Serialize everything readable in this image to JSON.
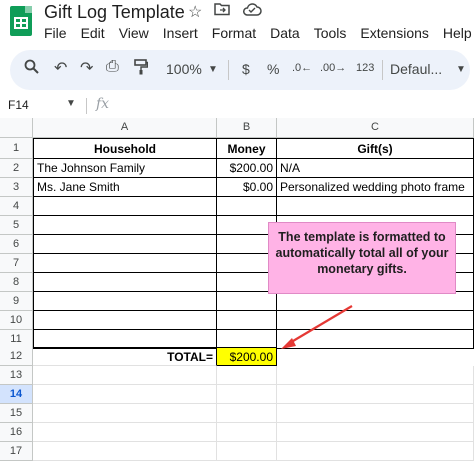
{
  "title_bar": {
    "doc_title": "Gift Log Template",
    "icons": [
      "star-icon",
      "move-to-folder-icon",
      "cloud-status-icon"
    ]
  },
  "menu": {
    "items": [
      "File",
      "Edit",
      "View",
      "Insert",
      "Format",
      "Data",
      "Tools",
      "Extensions",
      "Help"
    ]
  },
  "toolbar": {
    "search_icon": "⌕",
    "undo_icon": "↶",
    "redo_icon": "↷",
    "print_icon": "⎙",
    "paint_format_icon": "⛏",
    "zoom": "100%",
    "currency": "$",
    "percent": "%",
    "decrease_decimal": ".0←",
    "increase_decimal": ".00→",
    "more_formats": "123",
    "font": "Defaul..."
  },
  "formula_bar": {
    "name_box": "F14",
    "fx_label": "fx",
    "value": ""
  },
  "columns": [
    "A",
    "B",
    "C"
  ],
  "rows": [
    "1",
    "2",
    "3",
    "4",
    "5",
    "6",
    "7",
    "8",
    "9",
    "10",
    "11",
    "12",
    "13",
    "14",
    "15",
    "16",
    "17"
  ],
  "selected_row": "14",
  "sheet": {
    "header": {
      "household": "Household",
      "money": "Money",
      "gifts": "Gift(s)"
    },
    "entries": [
      {
        "household": "The Johnson Family",
        "money": "$200.00",
        "gift": "N/A"
      },
      {
        "household": "Ms. Jane Smith",
        "money": "$0.00",
        "gift": "Personalized wedding photo frame"
      }
    ],
    "total_label": "TOTAL=",
    "total_value": "$200.00"
  },
  "callout": {
    "text": "The template is formatted to automatically total all of your monetary gifts."
  },
  "colors": {
    "total_highlight": "#ffff00",
    "callout_bg": "#ffb3e6",
    "arrow": "#e53935",
    "sheets_green": "#0f9d58",
    "toolbar_bg": "#edf2fa"
  }
}
